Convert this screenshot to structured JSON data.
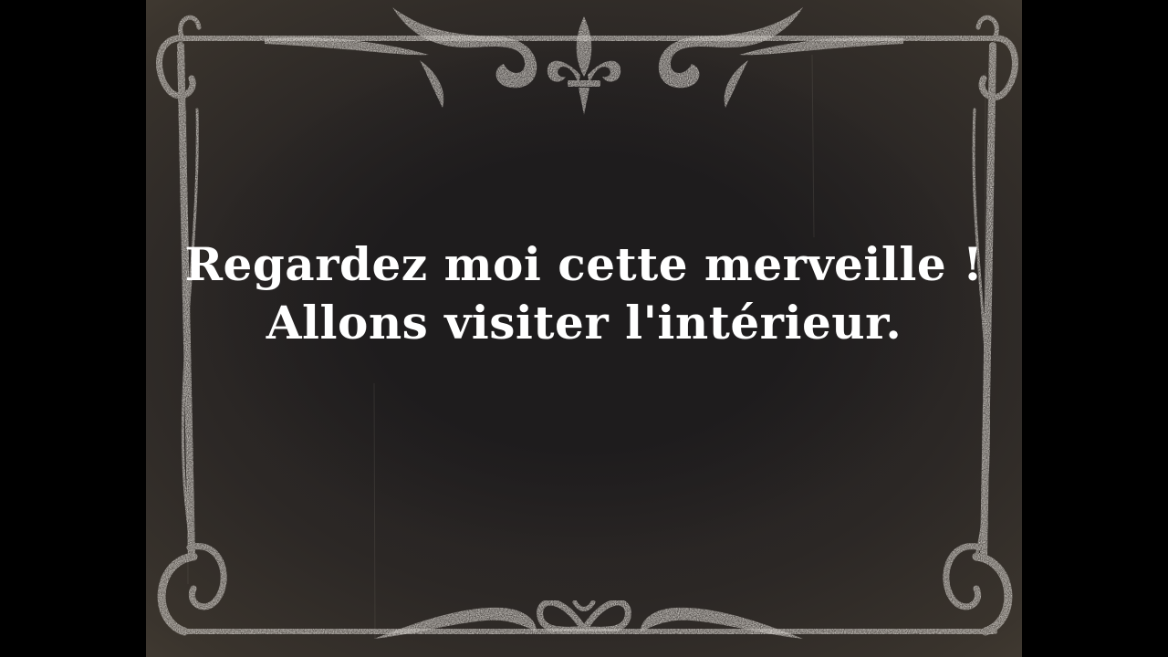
{
  "intertitle": {
    "line1": "Regardez moi cette merveille !",
    "line2": "Allons visiter l'intérieur."
  },
  "colors": {
    "background": "#000000",
    "card": "#1e1c1d",
    "ornament": "#cfcbc6",
    "text": "#ffffff"
  },
  "icons": {
    "top_center": "fleur-de-lis-icon",
    "bottom_center": "bow-ornament-icon"
  }
}
